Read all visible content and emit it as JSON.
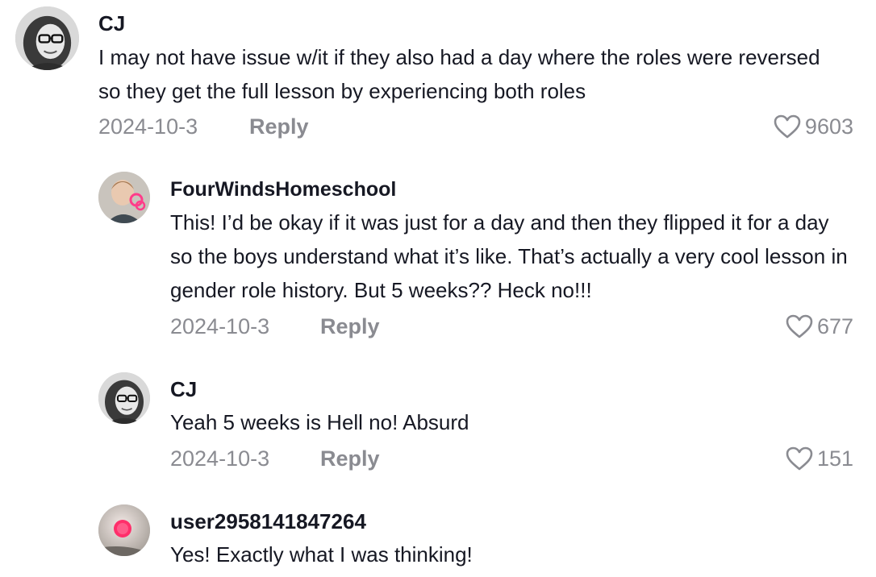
{
  "comments": [
    {
      "username": "CJ",
      "text": "I may not have issue w/it if they also had a day where the roles were reversed so they get the full lesson by experiencing both roles",
      "date": "2024-10-3",
      "reply_label": "Reply",
      "likes": "9603",
      "avatar_icon": "user-photo-glasses"
    },
    {
      "username": "FourWindsHomeschool",
      "text": "This! I’d be okay if it was just for a day and then they flipped it for a day so the boys understand what it’s like. That’s actually a very cool lesson in gender role history. But 5 weeks?? Heck no!!!",
      "date": "2024-10-3",
      "reply_label": "Reply",
      "likes": "677",
      "avatar_icon": "user-photo-child"
    },
    {
      "username": "CJ",
      "text": "Yeah 5 weeks is Hell no! Absurd",
      "date": "2024-10-3",
      "reply_label": "Reply",
      "likes": "151",
      "avatar_icon": "user-photo-glasses"
    },
    {
      "username": "user2958141847264",
      "text": "Yes! Exactly what I was thinking!",
      "avatar_icon": "user-photo-pink-dot"
    }
  ],
  "colors": {
    "text": "#161823",
    "muted": "#8a8b91",
    "background": "#ffffff"
  }
}
